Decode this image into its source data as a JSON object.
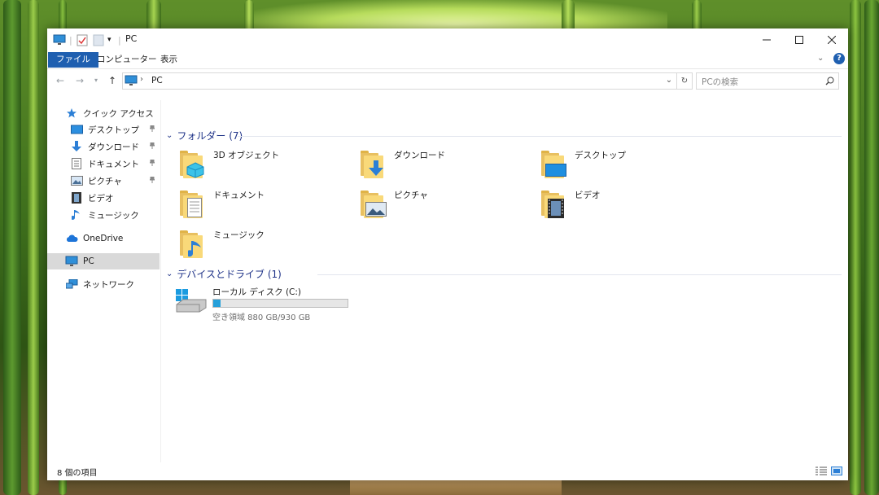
{
  "window": {
    "title": "PC"
  },
  "ribbon": {
    "tabs": [
      "ファイル",
      "コンピューター",
      "表示"
    ]
  },
  "address": {
    "location": "PC",
    "search_placeholder": "PCの検索"
  },
  "sidebar": {
    "quick_access": "クイック アクセス",
    "quick_items": [
      "デスクトップ",
      "ダウンロード",
      "ドキュメント",
      "ピクチャ",
      "ビデオ",
      "ミュージック"
    ],
    "onedrive": "OneDrive",
    "pc": "PC",
    "network": "ネットワーク"
  },
  "folders_group": {
    "label": "フォルダー (7)"
  },
  "folders": [
    "3D オブジェクト",
    "ダウンロード",
    "デスクトップ",
    "ドキュメント",
    "ピクチャ",
    "ビデオ",
    "ミュージック"
  ],
  "drives_group": {
    "label": "デバイスとドライブ (1)"
  },
  "drive": {
    "name": "ローカル ディスク (C:)",
    "free_text": "空き領域 880 GB/930 GB",
    "used_fraction": 0.054
  },
  "status": {
    "item_count": "8 個の項目"
  },
  "colors": {
    "accent": "#1f5fb0",
    "group_header": "#1e3287",
    "drive_bar": "#26a0da",
    "folder": "#f9d979"
  }
}
